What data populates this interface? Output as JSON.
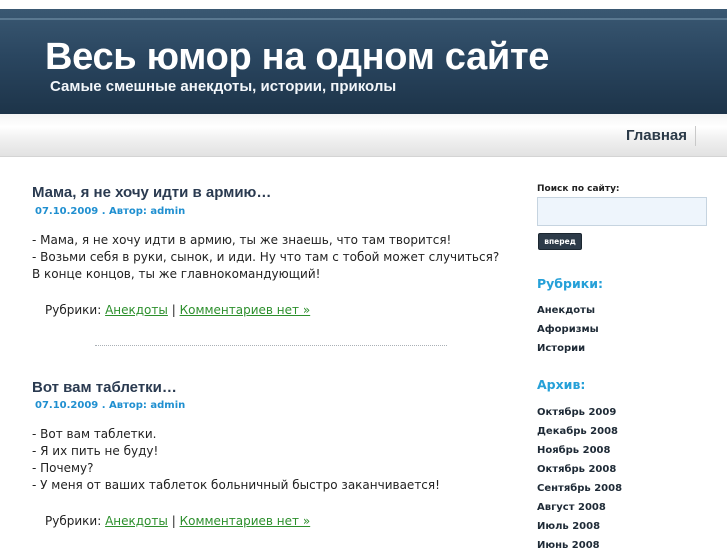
{
  "header": {
    "title": "Весь юмор на одном сайте",
    "subtitle": "Самые смешные анекдоты, истории, приколы"
  },
  "nav": {
    "home": "Главная"
  },
  "posts": [
    {
      "title": "Мама, я не хочу идти в армию…",
      "meta": "07.10.2009 . Автор: admin",
      "lines": [
        "- Мама, я не хочу идти в армию, ты же знаешь, что там творится!",
        "- Возьми себя в руки, сынок, и иди. Ну что там с тобой может случиться? В конце концов, ты же главнокомандующий!"
      ],
      "footer_prefix": "Рубрики:",
      "category": "Анекдоты",
      "separator": "|",
      "comments": "Комментариев нет »"
    },
    {
      "title": "Вот вам таблетки…",
      "meta": "07.10.2009 . Автор: admin",
      "lines": [
        "- Вот вам таблетки.",
        "- Я их пить не буду!",
        "- Почему?",
        "- У меня от ваших таблеток больничный быстро заканчивается!"
      ],
      "footer_prefix": "Рубрики:",
      "category": "Анекдоты",
      "separator": "|",
      "comments": "Комментариев нет »"
    }
  ],
  "sidebar": {
    "search_label": "Поиск по сайту:",
    "search_value": "",
    "search_button": "вперед",
    "categories_heading": "Рубрики:",
    "categories": [
      "Анекдоты",
      "Афоризмы",
      "Истории"
    ],
    "archive_heading": "Архив:",
    "archive": [
      "Октябрь 2009",
      "Декабрь 2008",
      "Ноябрь 2008",
      "Октябрь 2008",
      "Сентябрь 2008",
      "Август 2008",
      "Июль 2008",
      "Июнь 2008"
    ]
  },
  "colors": {
    "header_bg": "#2a4660",
    "meta_blue": "#1f8fd0",
    "sidebar_heading": "#25a0d8",
    "link_green": "#2c8f2c"
  }
}
